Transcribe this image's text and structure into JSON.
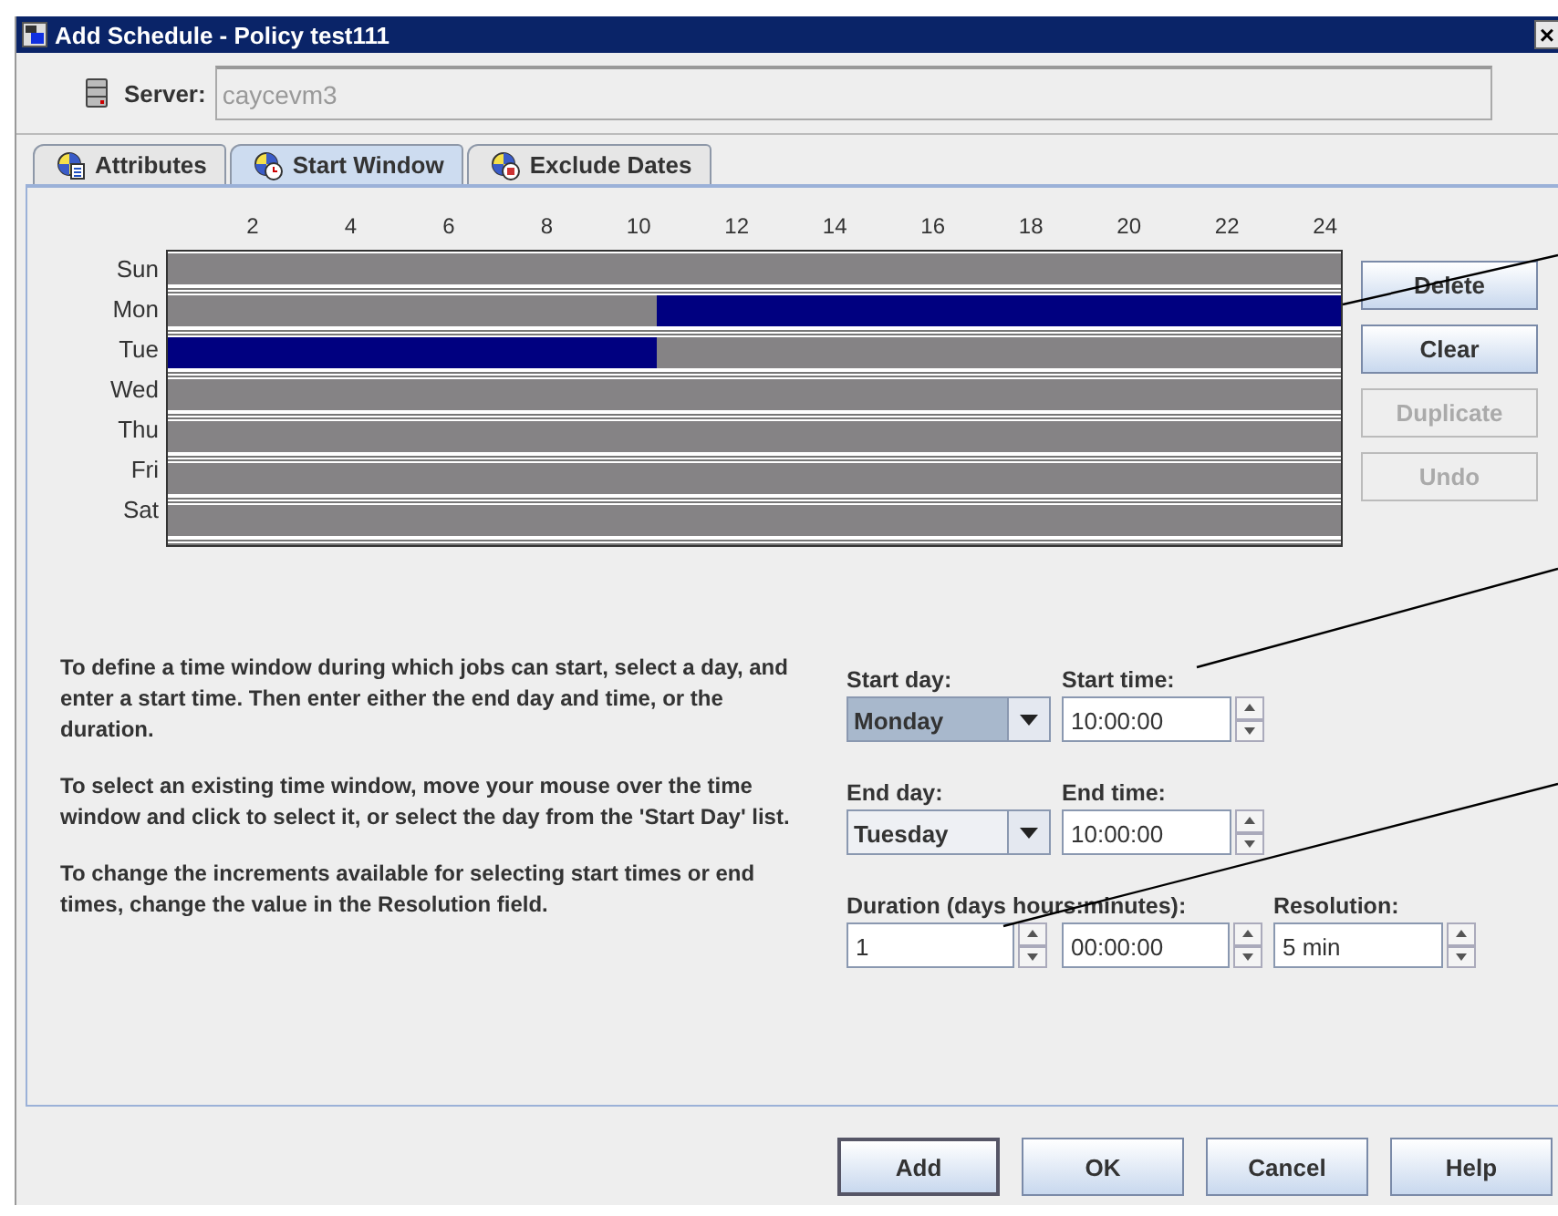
{
  "window": {
    "title": "Add Schedule - Policy test111",
    "close": "×"
  },
  "server": {
    "label": "Server:",
    "value": "caycevm3"
  },
  "tabs": [
    {
      "label": "Attributes",
      "selected": false,
      "kind": "attributes"
    },
    {
      "label": "Start Window",
      "selected": true,
      "kind": "clock"
    },
    {
      "label": "Exclude Dates",
      "selected": false,
      "kind": "exclude"
    }
  ],
  "schedule": {
    "hour_labels": [
      "2",
      "4",
      "6",
      "8",
      "10",
      "12",
      "14",
      "16",
      "18",
      "20",
      "22",
      "24"
    ],
    "days": [
      {
        "label": "Sun",
        "hours": [
          false,
          false,
          false,
          false,
          false,
          false,
          false,
          false,
          false,
          false,
          false,
          false,
          false,
          false,
          false,
          false,
          false,
          false,
          false,
          false,
          false,
          false,
          false,
          false
        ]
      },
      {
        "label": "Mon",
        "hours": [
          false,
          false,
          false,
          false,
          false,
          false,
          false,
          false,
          false,
          false,
          true,
          true,
          true,
          true,
          true,
          true,
          true,
          true,
          true,
          true,
          true,
          true,
          true,
          true
        ]
      },
      {
        "label": "Tue",
        "hours": [
          true,
          true,
          true,
          true,
          true,
          true,
          true,
          true,
          true,
          true,
          false,
          false,
          false,
          false,
          false,
          false,
          false,
          false,
          false,
          false,
          false,
          false,
          false,
          false
        ]
      },
      {
        "label": "Wed",
        "hours": [
          false,
          false,
          false,
          false,
          false,
          false,
          false,
          false,
          false,
          false,
          false,
          false,
          false,
          false,
          false,
          false,
          false,
          false,
          false,
          false,
          false,
          false,
          false,
          false
        ]
      },
      {
        "label": "Thu",
        "hours": [
          false,
          false,
          false,
          false,
          false,
          false,
          false,
          false,
          false,
          false,
          false,
          false,
          false,
          false,
          false,
          false,
          false,
          false,
          false,
          false,
          false,
          false,
          false,
          false
        ]
      },
      {
        "label": "Fri",
        "hours": [
          false,
          false,
          false,
          false,
          false,
          false,
          false,
          false,
          false,
          false,
          false,
          false,
          false,
          false,
          false,
          false,
          false,
          false,
          false,
          false,
          false,
          false,
          false,
          false
        ]
      },
      {
        "label": "Sat",
        "hours": [
          false,
          false,
          false,
          false,
          false,
          false,
          false,
          false,
          false,
          false,
          false,
          false,
          false,
          false,
          false,
          false,
          false,
          false,
          false,
          false,
          false,
          false,
          false,
          false
        ]
      }
    ]
  },
  "side_buttons": [
    {
      "label": "Delete",
      "disabled": false
    },
    {
      "label": "Clear",
      "disabled": false
    },
    {
      "label": "Duplicate",
      "disabled": true
    },
    {
      "label": "Undo",
      "disabled": true
    }
  ],
  "instructions": [
    "To define a time window during which jobs can start, select a day, and enter a start time. Then enter either the end day and time, or the duration.",
    "To select an existing time window, move your mouse over the time window and click to select it, or select the day from the 'Start Day' list.",
    "To change the increments available for selecting start times or end times, change the value in the Resolution field."
  ],
  "start": {
    "day_label": "Start day:",
    "day": "Monday",
    "day_focused": true,
    "time_label": "Start time:",
    "time": "10:00:00"
  },
  "end": {
    "day_label": "End day:",
    "day": "Tuesday",
    "day_focused": false,
    "time_label": "End time:",
    "time": "10:00:00"
  },
  "duration": {
    "label": "Duration (days hours:minutes):",
    "days": "1",
    "time": "00:00:00",
    "resolution_label": "Resolution:",
    "resolution": "5 min"
  },
  "buttons": [
    {
      "label": "Add",
      "default": true
    },
    {
      "label": "OK",
      "default": false
    },
    {
      "label": "Cancel",
      "default": false
    },
    {
      "label": "Help",
      "default": false
    }
  ]
}
